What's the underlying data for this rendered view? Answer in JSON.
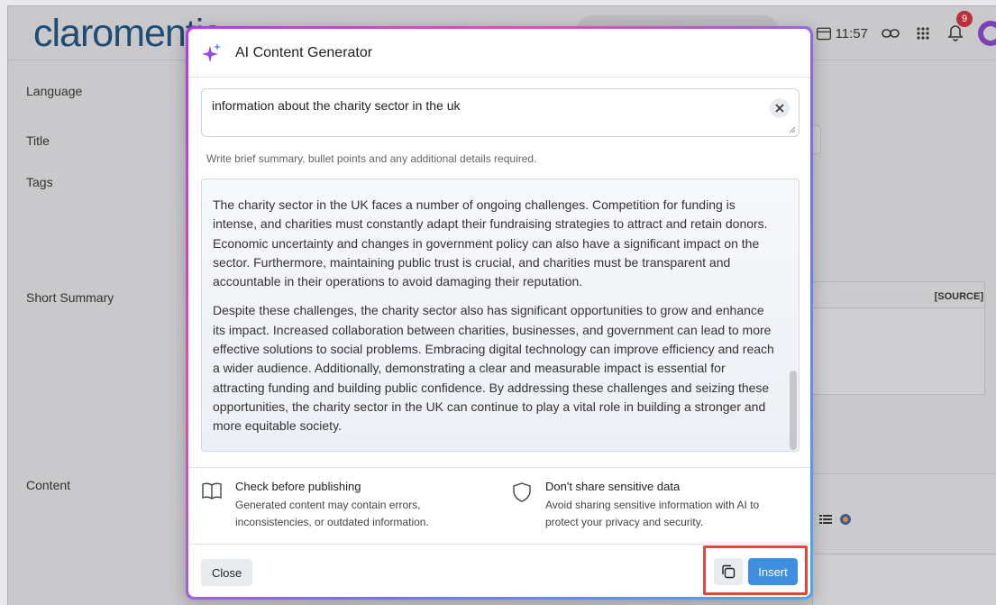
{
  "app": {
    "logo_text": "claromentis",
    "time": "11:57",
    "notification_count": "9",
    "form_labels": {
      "language": "Language",
      "title": "Title",
      "tags": "Tags",
      "short_summary": "Short Summary",
      "content": "Content"
    },
    "source_label": "[SOURCE]"
  },
  "modal": {
    "title": "AI Content Generator",
    "prompt_value": "information about the charity sector in the uk",
    "prompt_hint": "Write brief summary, bullet points and any additional details required.",
    "output_paragraphs": [
      "The charity sector in the UK faces a number of ongoing challenges. Competition for funding is intense, and charities must constantly adapt their fundraising strategies to attract and retain donors. Economic uncertainty and changes in government policy can also have a significant impact on the sector. Furthermore, maintaining public trust is crucial, and charities must be transparent and accountable in their operations to avoid damaging their reputation.",
      "Despite these challenges, the charity sector also has significant opportunities to grow and enhance its impact. Increased collaboration between charities, businesses, and government can lead to more effective solutions to social problems. Embracing digital technology can improve efficiency and reach a wider audience. Additionally, demonstrating a clear and measurable impact is essential for attracting funding and building public confidence. By addressing these challenges and seizing these opportunities, the charity sector in the UK can continue to play a vital role in building a stronger and more equitable society."
    ],
    "notices": [
      {
        "title": "Check before publishing",
        "description": "Generated content may contain errors, inconsistencies, or outdated information."
      },
      {
        "title": "Don't share sensitive data",
        "description": "Avoid sharing sensitive information with AI to protect your privacy and security."
      }
    ],
    "close_label": "Close",
    "insert_label": "Insert"
  },
  "colors": {
    "insert_button": "#3f8fe0",
    "highlight": "#e0463b",
    "logo": "#1f4c73",
    "badge": "#b7303a"
  }
}
